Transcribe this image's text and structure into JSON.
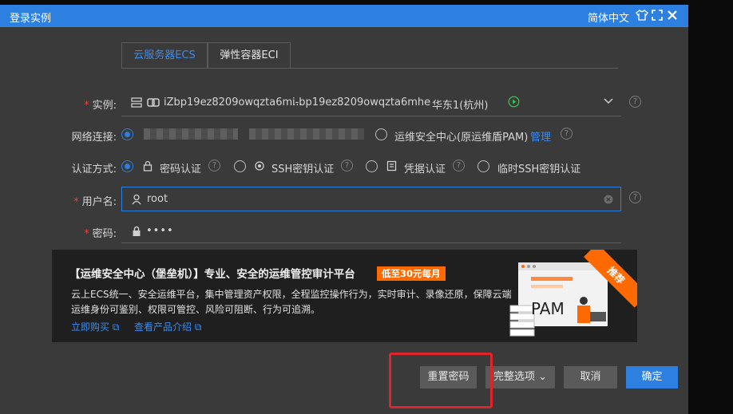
{
  "dialog": {
    "title": "登录实例",
    "language": "简体中文",
    "icons": [
      "shirt-icon",
      "expand-icon",
      "close-icon"
    ]
  },
  "tabs": [
    {
      "label": "云服务器ECS",
      "active": true
    },
    {
      "label": "弹性容器ECI",
      "active": false
    }
  ],
  "instance": {
    "label": "实例:",
    "name": "iZbp19ez8209owqzta6m...",
    "id": "i-bp19ez8209owqzta6mhe",
    "region": "华东1(杭州)"
  },
  "network": {
    "label": "网络连接:",
    "option2": "运维安全中心(原运维盾PAM)",
    "manage_link": "管理"
  },
  "auth": {
    "label": "认证方式:",
    "options": [
      "密码认证",
      "SSH密钥认证",
      "凭据认证",
      "临时SSH密钥认证"
    ]
  },
  "username": {
    "label": "用户名:",
    "value": "root"
  },
  "password": {
    "label": "密码:",
    "value": "••••"
  },
  "promo": {
    "heading": "【运维安全中心（堡垒机）】专业、安全的运维管控审计平台",
    "badge": "低至30元每月",
    "desc_line1": "云上ECS统一、安全运维平台，集中管理资产权限，全程监控操作行为，实时审计、录像还原，保障云端",
    "desc_line2": "运维身份可鉴别、权限可管控、风险可阻断、行为可追溯。",
    "link_buy": "立即购买",
    "link_intro": "查看产品介绍",
    "ribbon": "推荐",
    "art_text": "PAM"
  },
  "buttons": {
    "reset": "重置密码",
    "options": "完整选项",
    "cancel": "取消",
    "confirm": "确定"
  },
  "colors": {
    "accent": "#2d7fe0",
    "highlight": "#e0242a",
    "promo_orange": "#ff6a00"
  }
}
